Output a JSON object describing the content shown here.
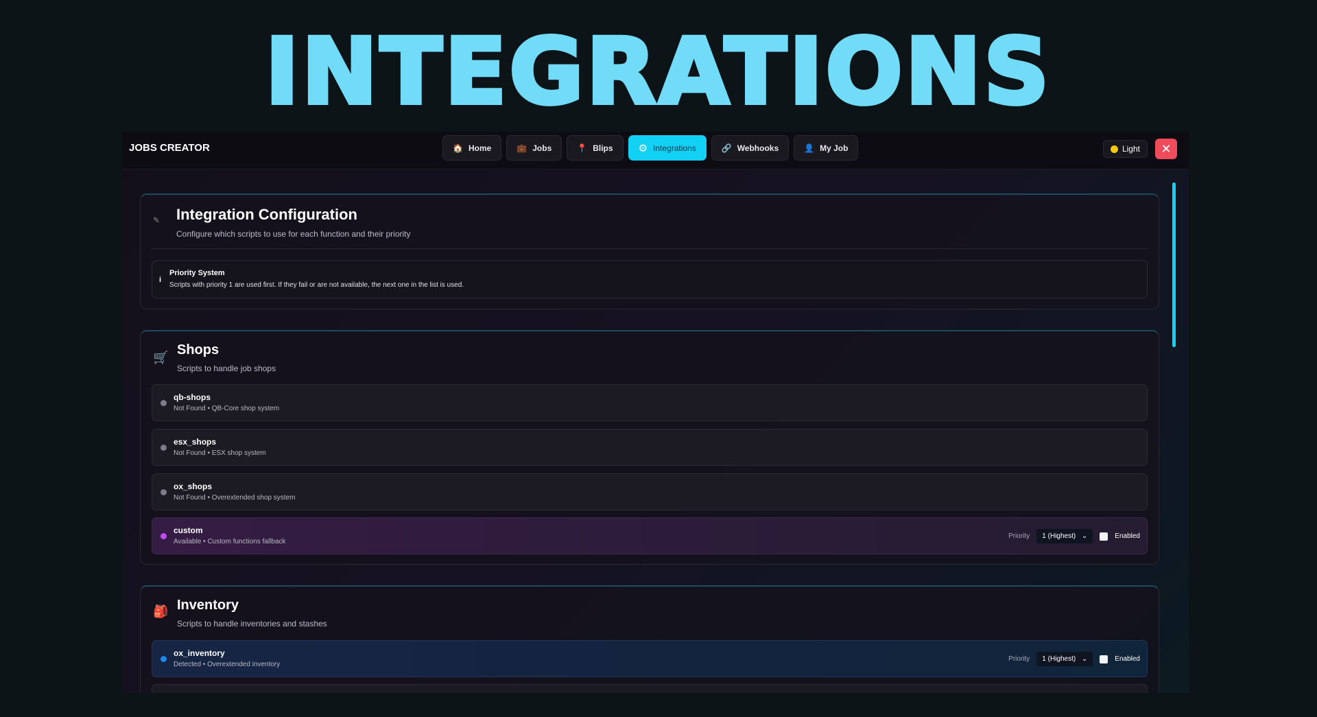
{
  "banner": "INTEGRATIONS",
  "header": {
    "brand": "JOBS CREATOR",
    "nav": [
      {
        "label": "Home",
        "icon": "home-icon",
        "glyph": "🏠"
      },
      {
        "label": "Jobs",
        "icon": "briefcase-icon",
        "glyph": "💼"
      },
      {
        "label": "Blips",
        "icon": "pin-icon",
        "glyph": "📍"
      },
      {
        "label": "Integrations",
        "icon": "gear-icon",
        "glyph": "⚙"
      },
      {
        "label": "Webhooks",
        "icon": "link-icon",
        "glyph": "🔗"
      },
      {
        "label": "My Job",
        "icon": "user-icon",
        "glyph": "👤"
      }
    ],
    "active": "Integrations",
    "theme_label": "Light",
    "close": "✕"
  },
  "config": {
    "title": "Integration Configuration",
    "subtitle": "Configure which scripts to use for each function and their priority",
    "info_title": "Priority System",
    "info_text": "Scripts with priority 1 are used first. If they fail or are not available, the next one in the list is used."
  },
  "shops": {
    "title": "Shops",
    "subtitle": "Scripts to handle job shops",
    "rows": [
      {
        "name": "qb-shops",
        "status": "Not Found • QB-Core shop system"
      },
      {
        "name": "esx_shops",
        "status": "Not Found • ESX shop system"
      },
      {
        "name": "ox_shops",
        "status": "Not Found • Overextended shop system"
      },
      {
        "name": "custom",
        "status": "Available • Custom functions fallback",
        "priority_label": "Priority",
        "priority": "1 (Highest)",
        "enabled_label": "Enabled"
      }
    ]
  },
  "inventory": {
    "title": "Inventory",
    "subtitle": "Scripts to handle inventories and stashes",
    "rows": [
      {
        "name": "ox_inventory",
        "status": "Detected • Overextended inventory",
        "priority_label": "Priority",
        "priority": "1 (Highest)",
        "enabled_label": "Enabled"
      }
    ]
  },
  "colors": {
    "accent": "#12d1f5",
    "close": "#f04b5a",
    "available": "#c04cf0",
    "detected": "#1e88f0",
    "notfound": "#7c7c88"
  }
}
